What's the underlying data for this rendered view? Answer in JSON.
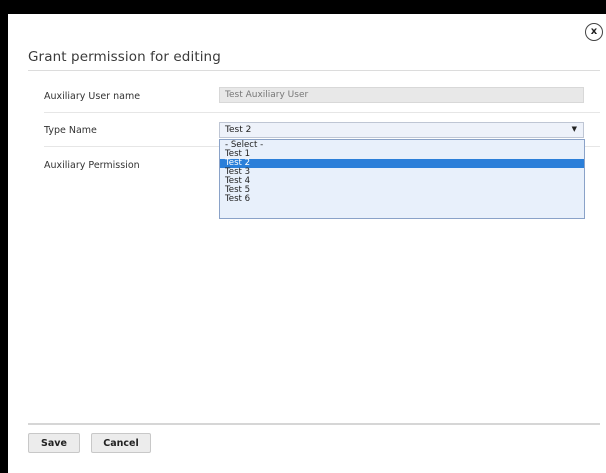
{
  "dialog": {
    "title": "Grant permission for editing",
    "close_label": "x"
  },
  "form": {
    "auxiliary_user_name_label": "Auxiliary User name",
    "auxiliary_user_name_value": "Test Auxiliary User",
    "type_name_label": "Type Name",
    "type_name_selected": "Test 2",
    "auxiliary_permission_label": "Auxiliary Permission"
  },
  "dropdown": {
    "options": [
      "- Select -",
      "Test 1",
      "Test 2",
      "Test 3",
      "Test 4",
      "Test 5",
      "Test 6"
    ],
    "selected_index": 2,
    "arrow": "▼"
  },
  "footer": {
    "save_label": "Save",
    "cancel_label": "Cancel"
  },
  "colors": {
    "selected_option": "#2b7fd9",
    "dropdown_background": "#e8f0fb",
    "readonly_background": "#e8e8e8"
  }
}
